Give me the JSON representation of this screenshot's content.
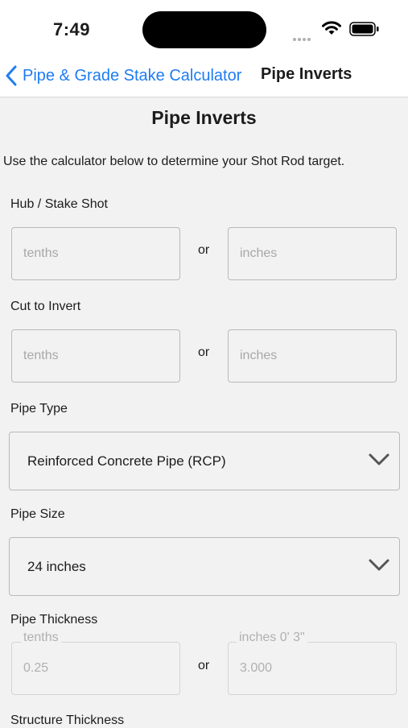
{
  "status_bar": {
    "time": "7:49"
  },
  "nav": {
    "back_label": "Pipe & Grade Stake Calculator",
    "title": "Pipe Inverts"
  },
  "page": {
    "title": "Pipe Inverts",
    "intro": "Use the calculator below to determine your Shot Rod target."
  },
  "hub_stake_shot": {
    "label": "Hub / Stake Shot",
    "tenths_placeholder": "tenths",
    "or": "or",
    "inches_placeholder": "inches"
  },
  "cut_to_invert": {
    "label": "Cut to Invert",
    "tenths_placeholder": "tenths",
    "or": "or",
    "inches_placeholder": "inches"
  },
  "pipe_type": {
    "label": "Pipe Type",
    "selected": "Reinforced Concrete Pipe (RCP)"
  },
  "pipe_size": {
    "label": "Pipe Size",
    "selected": "24 inches"
  },
  "pipe_thickness": {
    "label": "Pipe Thickness",
    "tenths_label": "tenths",
    "tenths_value": "0.25",
    "or": "or",
    "inches_label": "inches  0' 3\"",
    "inches_value": "3.000"
  },
  "structure_thickness": {
    "label": "Structure Thickness"
  },
  "colors": {
    "accent": "#1e7cf2",
    "background": "#f2f2f2",
    "border": "#b9b9b9"
  }
}
